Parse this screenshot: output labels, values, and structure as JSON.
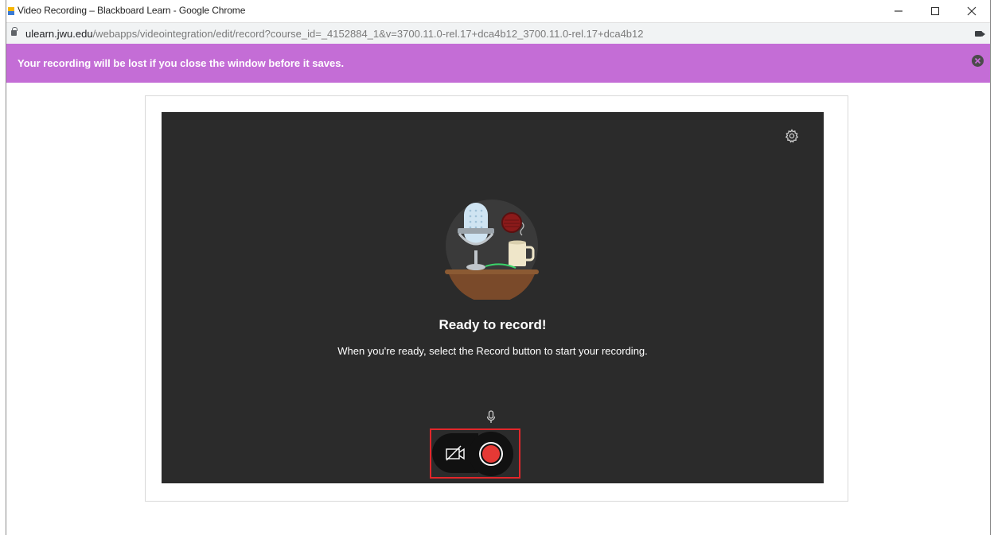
{
  "window": {
    "title": "Video Recording – Blackboard Learn - Google Chrome",
    "controls": {
      "minimize_icon": "minimize-icon",
      "maximize_icon": "maximize-icon",
      "close_icon": "close-icon"
    }
  },
  "address": {
    "host": "ulearn.jwu.edu",
    "path": "/webapps/videointegration/edit/record?course_id=_4152884_1&v=3700.11.0-rel.17+dca4b12_3700.11.0-rel.17+dca4b12"
  },
  "banner": {
    "message": "Your recording will be lost if you close the window before it saves.",
    "color": "#c46dd6"
  },
  "recorder": {
    "title": "Ready to record!",
    "subtitle": "When you're ready, select the Record button to start your recording.",
    "settings_icon": "gear-icon",
    "camera_toggle_icon": "camera-off-icon",
    "record_icon": "record-icon",
    "mic_icon": "microphone-icon",
    "record_color": "#e53935",
    "highlight_color": "#e2262a"
  }
}
